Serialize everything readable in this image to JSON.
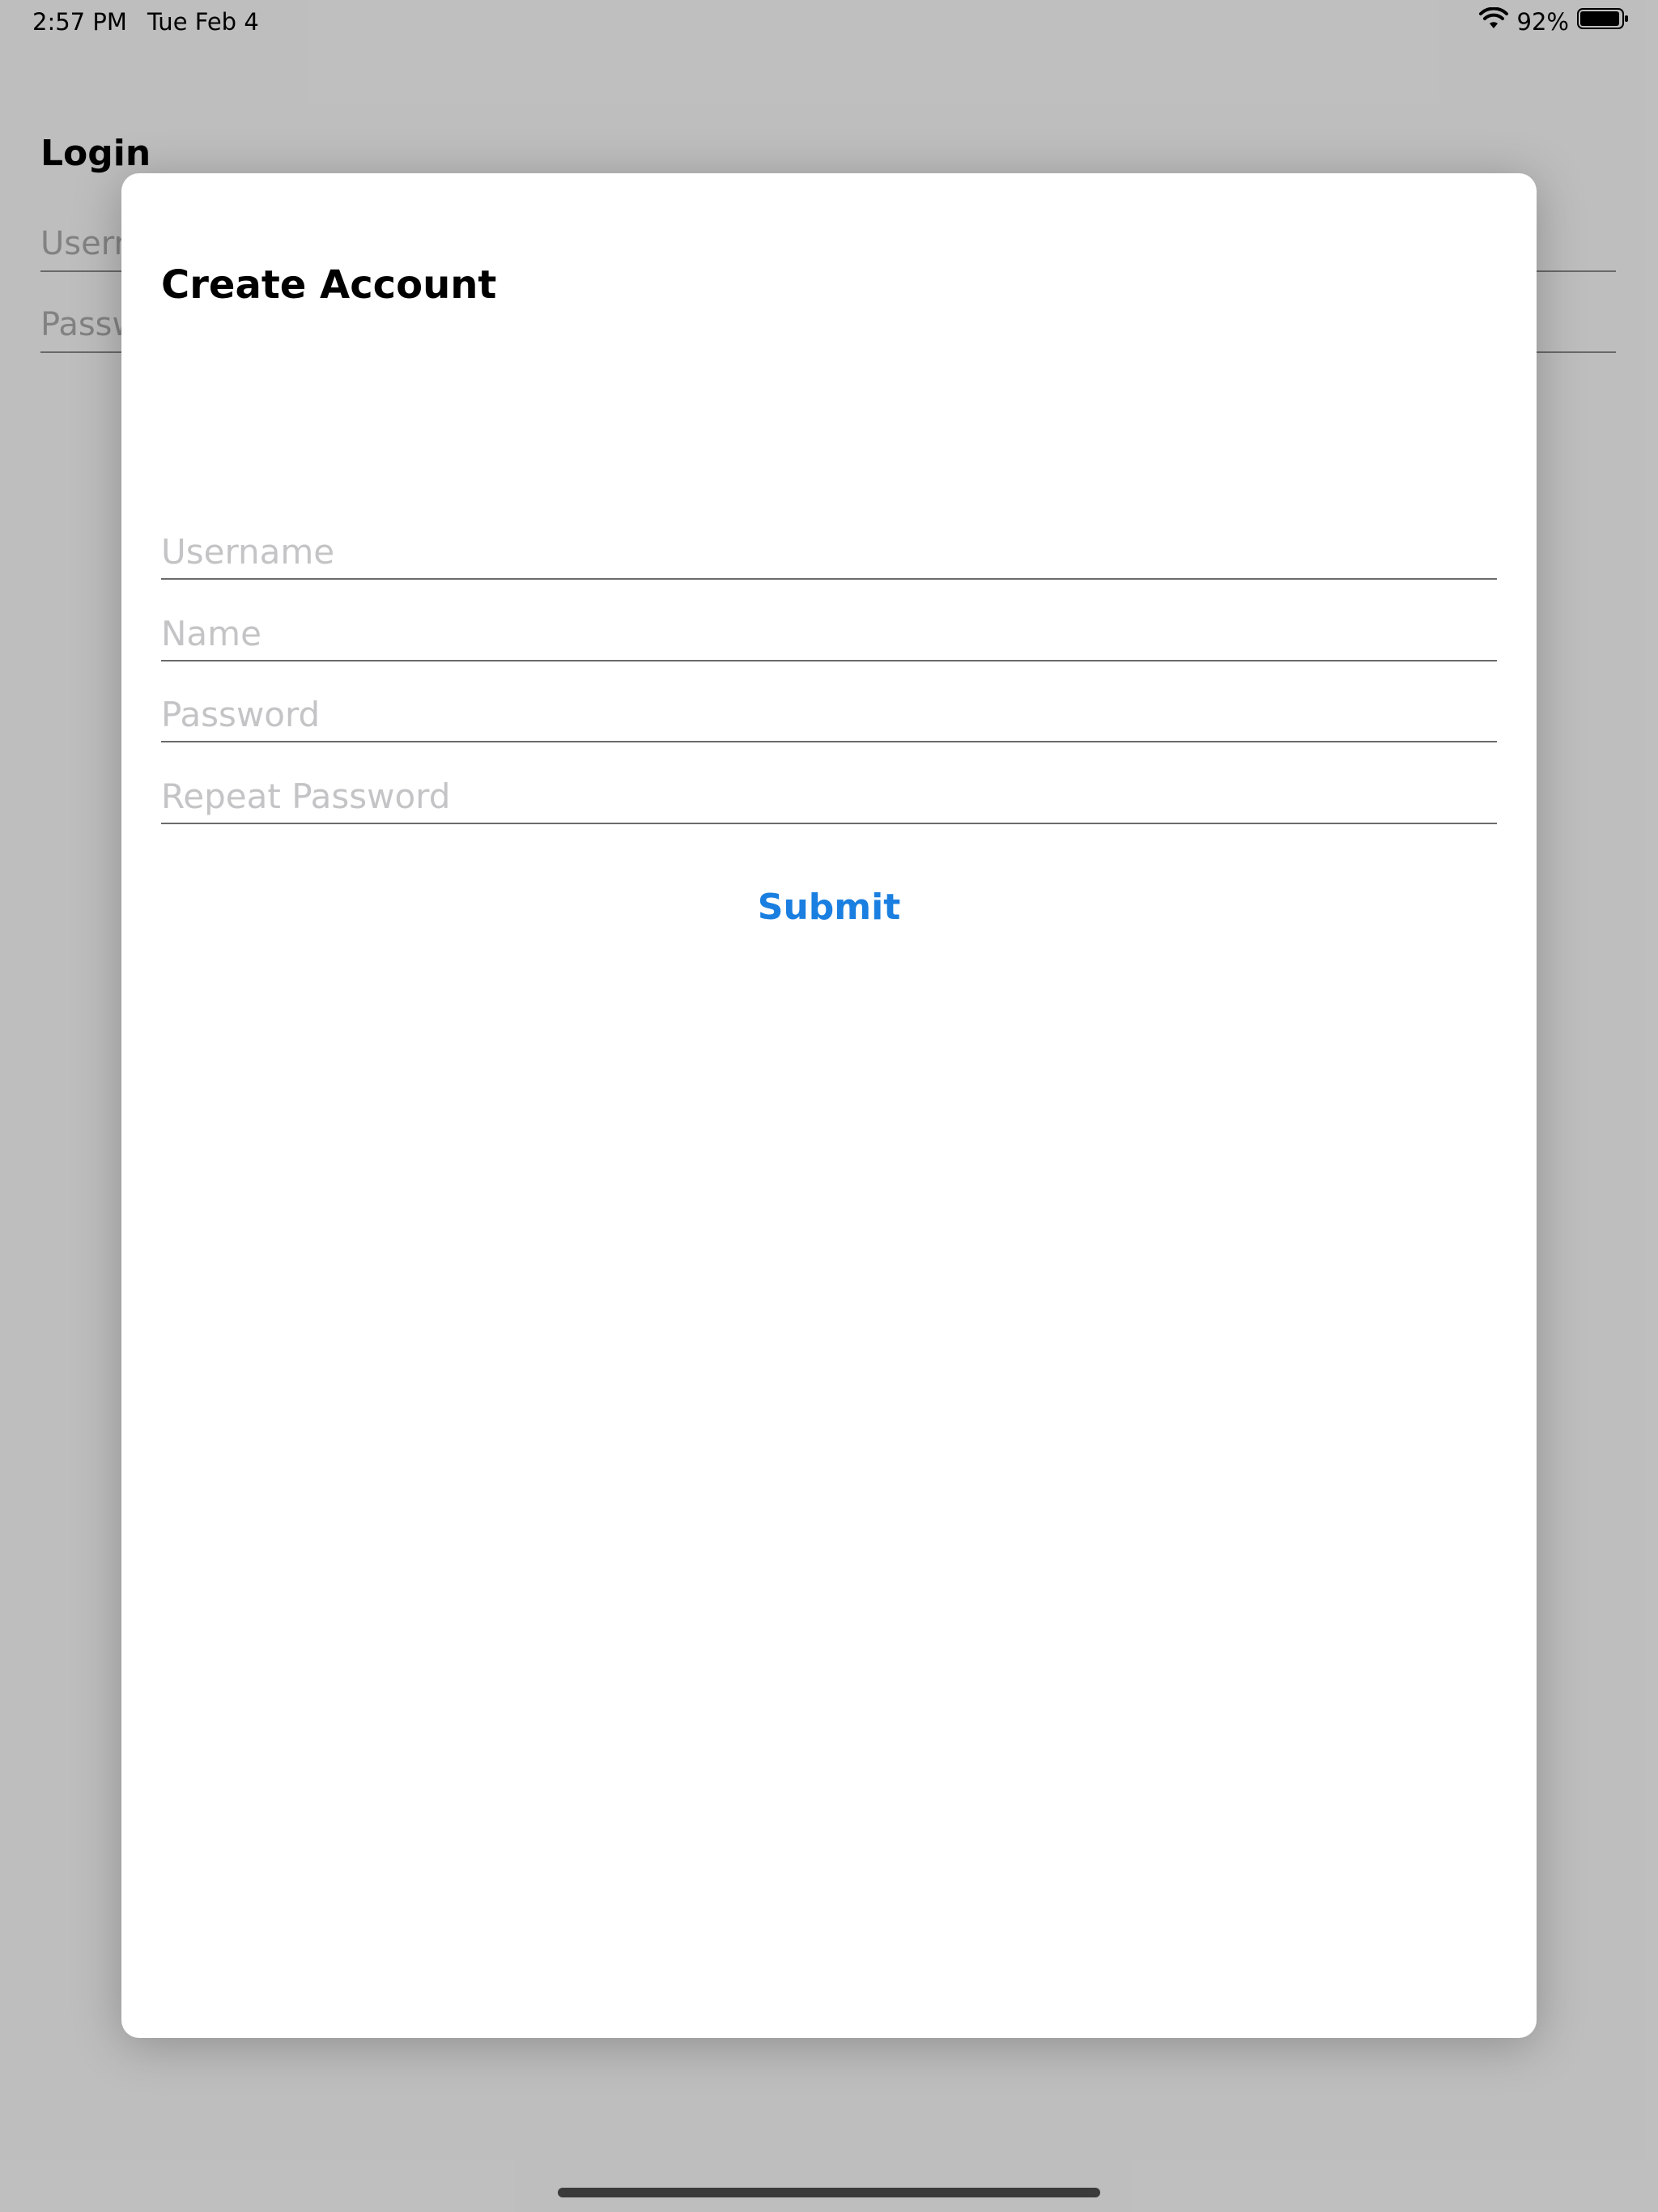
{
  "status_bar": {
    "time": "2:57 PM",
    "date": "Tue Feb 4",
    "battery_percent": "92%",
    "icons": [
      "wifi-icon",
      "battery-icon"
    ]
  },
  "background": {
    "title": "Login",
    "username_placeholder": "Username",
    "password_placeholder": "Password"
  },
  "sheet": {
    "title": "Create Account",
    "fields": {
      "username_placeholder": "Username",
      "name_placeholder": "Name",
      "password_placeholder": "Password",
      "repeat_password_placeholder": "Repeat Password"
    },
    "submit_label": "Submit"
  },
  "colors": {
    "accent": "#1a7fe0",
    "placeholder": "#c4c4c6",
    "backdrop": "#c9c9c9"
  }
}
